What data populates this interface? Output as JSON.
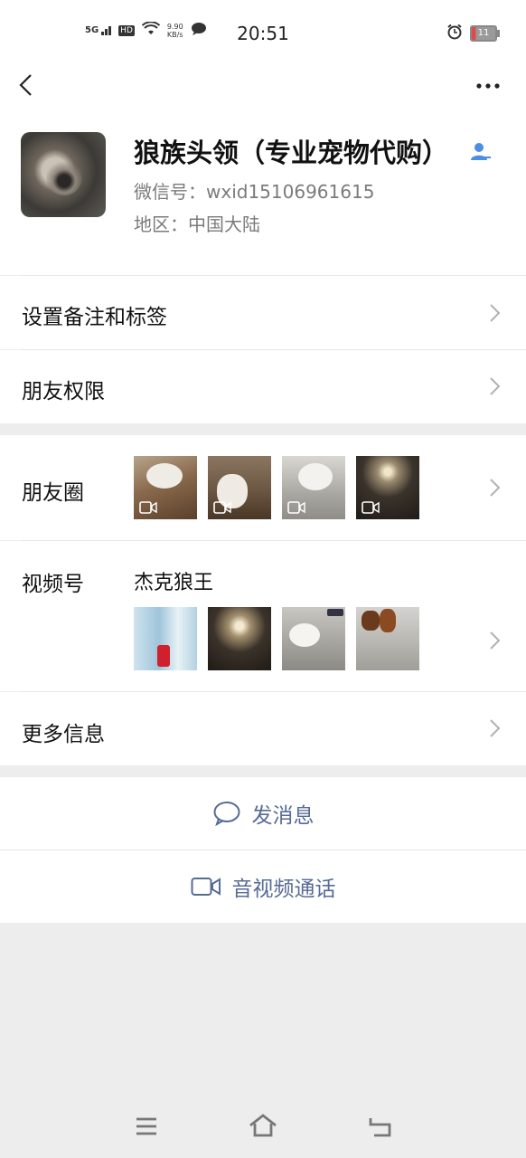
{
  "status_bar": {
    "signal_label": "5G",
    "hd_label": "HD",
    "speed_value": "9.90",
    "speed_unit": "KB/s",
    "time": "20:51",
    "battery": "11"
  },
  "profile": {
    "name": "狼族头领（专业宠物代购）",
    "wechat_id": "微信号：wxid15106961615",
    "region": "地区：中国大陆"
  },
  "menu": {
    "remark_tags": "设置备注和标签",
    "friend_permissions": "朋友权限",
    "moments": "朋友圈",
    "channels": "视频号",
    "channels_name": "杰克狼王",
    "more_info": "更多信息"
  },
  "actions": {
    "send_message": "发消息",
    "av_call": "音视频通话"
  },
  "colors": {
    "link_blue": "#576b95",
    "background": "#ededed",
    "verified_blue": "#4a90e2"
  },
  "moments_thumbs": [
    {
      "icon": "video-icon",
      "palette": "white-dog-dirt"
    },
    {
      "icon": "video-icon",
      "palette": "white-dog-leaves"
    },
    {
      "icon": "video-icon",
      "palette": "white-dogs-road"
    },
    {
      "icon": "video-icon",
      "palette": "fireworks"
    }
  ],
  "channels_thumbs": [
    {
      "palette": "ice-waterfall"
    },
    {
      "palette": "fireworks"
    },
    {
      "palette": "white-dog-road"
    },
    {
      "palette": "brown-dogs"
    }
  ]
}
